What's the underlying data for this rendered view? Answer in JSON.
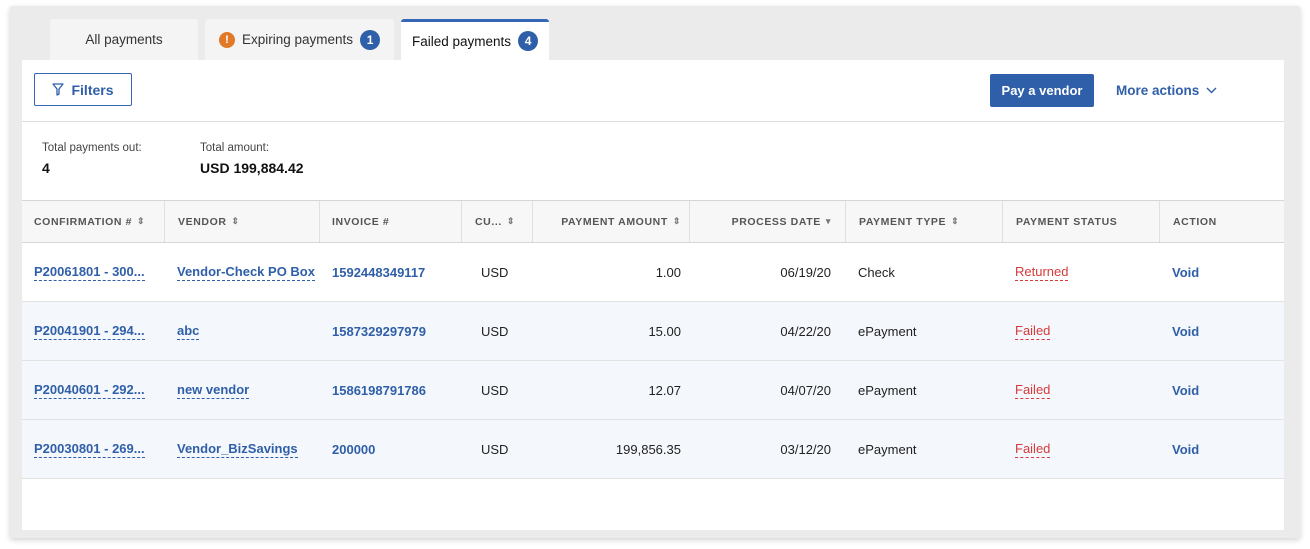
{
  "tabs": [
    {
      "label": "All payments"
    },
    {
      "label": "Expiring payments",
      "count": "1"
    },
    {
      "label": "Failed payments",
      "count": "4"
    }
  ],
  "toolbar": {
    "filters_label": "Filters",
    "pay_vendor_label": "Pay a vendor",
    "more_actions_label": "More actions"
  },
  "summary": {
    "total_payments_label": "Total payments out:",
    "total_payments_value": "4",
    "total_amount_label": "Total amount:",
    "total_amount_value": "USD 199,884.42"
  },
  "table": {
    "columns": [
      {
        "label": "CONFIRMATION #",
        "sort": "⇕"
      },
      {
        "label": "VENDOR",
        "sort": "⇕"
      },
      {
        "label": "INVOICE #",
        "sort": ""
      },
      {
        "label": "CU...",
        "sort": "⇕"
      },
      {
        "label": "PAYMENT AMOUNT",
        "sort": "⇕"
      },
      {
        "label": "PROCESS DATE",
        "sort": "▾"
      },
      {
        "label": "PAYMENT TYPE",
        "sort": "⇕"
      },
      {
        "label": "PAYMENT STATUS",
        "sort": ""
      },
      {
        "label": "ACTION",
        "sort": ""
      }
    ],
    "rows": [
      {
        "confirmation": "P20061801 - 300...",
        "vendor": "Vendor-Check PO Box",
        "invoice": "1592448349117",
        "currency": "USD",
        "amount": "1.00",
        "date": "06/19/20",
        "type": "Check",
        "status": "Returned",
        "action": "Void"
      },
      {
        "confirmation": "P20041901 - 294...",
        "vendor": "abc",
        "invoice": "1587329297979",
        "currency": "USD",
        "amount": "15.00",
        "date": "04/22/20",
        "type": "ePayment",
        "status": "Failed",
        "action": "Void"
      },
      {
        "confirmation": "P20040601 - 292...",
        "vendor": "new vendor",
        "invoice": "1586198791786",
        "currency": "USD",
        "amount": "12.07",
        "date": "04/07/20",
        "type": "ePayment",
        "status": "Failed",
        "action": "Void"
      },
      {
        "confirmation": "P20030801 - 269...",
        "vendor": "Vendor_BizSavings",
        "invoice": "200000",
        "currency": "USD",
        "amount": "199,856.35",
        "date": "03/12/20",
        "type": "ePayment",
        "status": "Failed",
        "action": "Void"
      }
    ]
  },
  "colors": {
    "accent": "#2f5fa8",
    "error": "#d63a3a",
    "warning": "#e07a28"
  },
  "icons": [
    "alert-icon",
    "filter-icon",
    "chevron-down-icon"
  ]
}
